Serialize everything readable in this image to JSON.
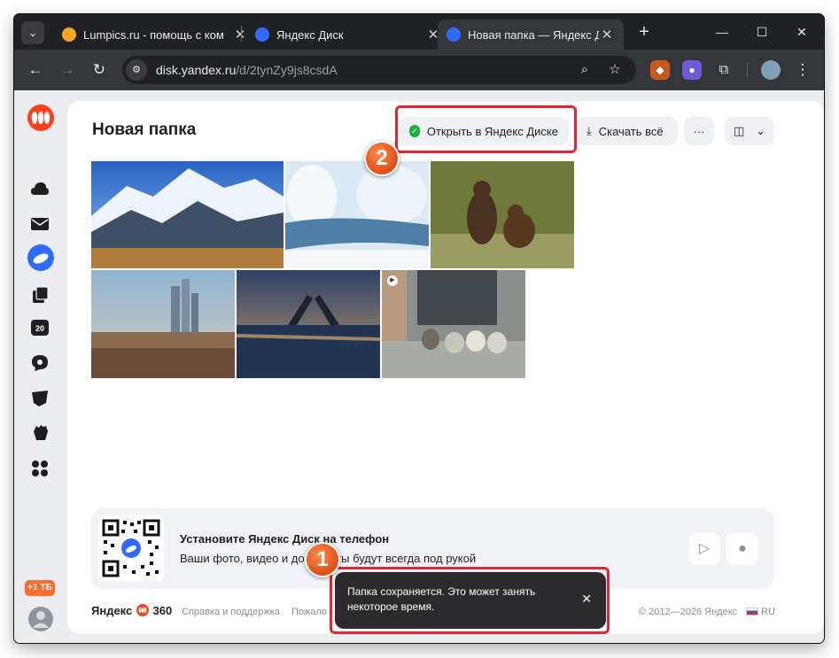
{
  "browser": {
    "tabs": [
      {
        "title": "Lumpics.ru - помощь с ком",
        "favicon_color": "#f5a623"
      },
      {
        "title": "Яндекс Диск",
        "favicon_color": "#2f6bff"
      },
      {
        "title": "Новая папка — Яндекс Дис",
        "favicon_color": "#2f6bff",
        "active": true
      }
    ],
    "new_tab_glyph": "+",
    "window_controls": {
      "minimize": "—",
      "maximize": "☐",
      "close": "✕"
    },
    "url_host": "disk.yandex.ru",
    "url_path": "/d/2tynZy9js8csdA"
  },
  "page": {
    "title": "Новая папка",
    "open_in_disk_label": "Открыть в Яндекс Диске",
    "download_all_label": "Скачать всё",
    "more_glyph": "···",
    "view_toggle_glyph": "⌄"
  },
  "rail": {
    "icons": [
      "yandex360-logo-icon",
      "cloud-icon",
      "mail-icon",
      "disk-icon",
      "docs-icon",
      "calendar-icon",
      "telemost-icon",
      "notes-icon",
      "hand-icon",
      "apps-icon"
    ],
    "calendar_day": "20",
    "promo_badge": "+1 ТБ"
  },
  "photos": [
    {
      "name": "photo-mountains",
      "has_video_badge": false
    },
    {
      "name": "photo-winter-river",
      "has_video_badge": false
    },
    {
      "name": "photo-bears",
      "has_video_badge": false
    },
    {
      "name": "photo-moscow-city",
      "has_video_badge": false
    },
    {
      "name": "photo-drawbridge",
      "has_video_badge": false
    },
    {
      "name": "photo-ducks-video",
      "has_video_badge": true
    }
  ],
  "promo": {
    "title": "Установите Яндекс Диск на телефон",
    "text": "Ваши фото, видео и документы будут всегда под рукой"
  },
  "footer": {
    "brand": "Яндекс",
    "brand_suffix": "360",
    "help_link": "Справка и поддержка",
    "partial_link": "Пожало",
    "copyright": "© 2012—2026 Яндекс",
    "lang": "RU"
  },
  "toast": {
    "message": "Папка сохраняется. Это может занять некоторое время.",
    "close_glyph": "✕"
  },
  "annotations": {
    "marker_1": "1",
    "marker_2": "2",
    "highlight_color": "#e3262d"
  }
}
